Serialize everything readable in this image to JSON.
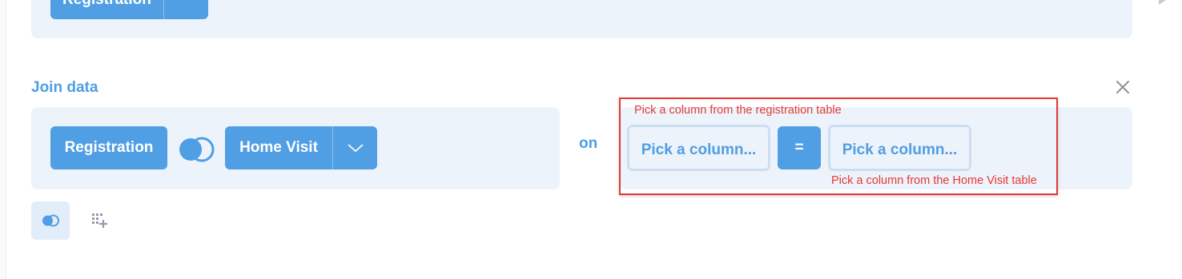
{
  "top_step": {
    "table_label": "Registration"
  },
  "join_step": {
    "title": "Join data",
    "left_table": "Registration",
    "right_table": "Home Visit",
    "on_label": "on",
    "left_column_placeholder": "Pick a column...",
    "operator": "=",
    "right_column_placeholder": "Pick a column..."
  },
  "annotations": {
    "left_hint": "Pick a column from the registration table",
    "right_hint": "Pick a column from the Home Visit table",
    "color": "#e53935"
  },
  "colors": {
    "brand": "#509ee3",
    "panel_bg": "#edf3fb",
    "picker_border": "#cbdff2"
  },
  "icons": {
    "close": "close-icon",
    "join_type": "venn-diagram-icon",
    "dropdown": "chevron-down-icon",
    "add_step": "grid-plus-icon"
  }
}
